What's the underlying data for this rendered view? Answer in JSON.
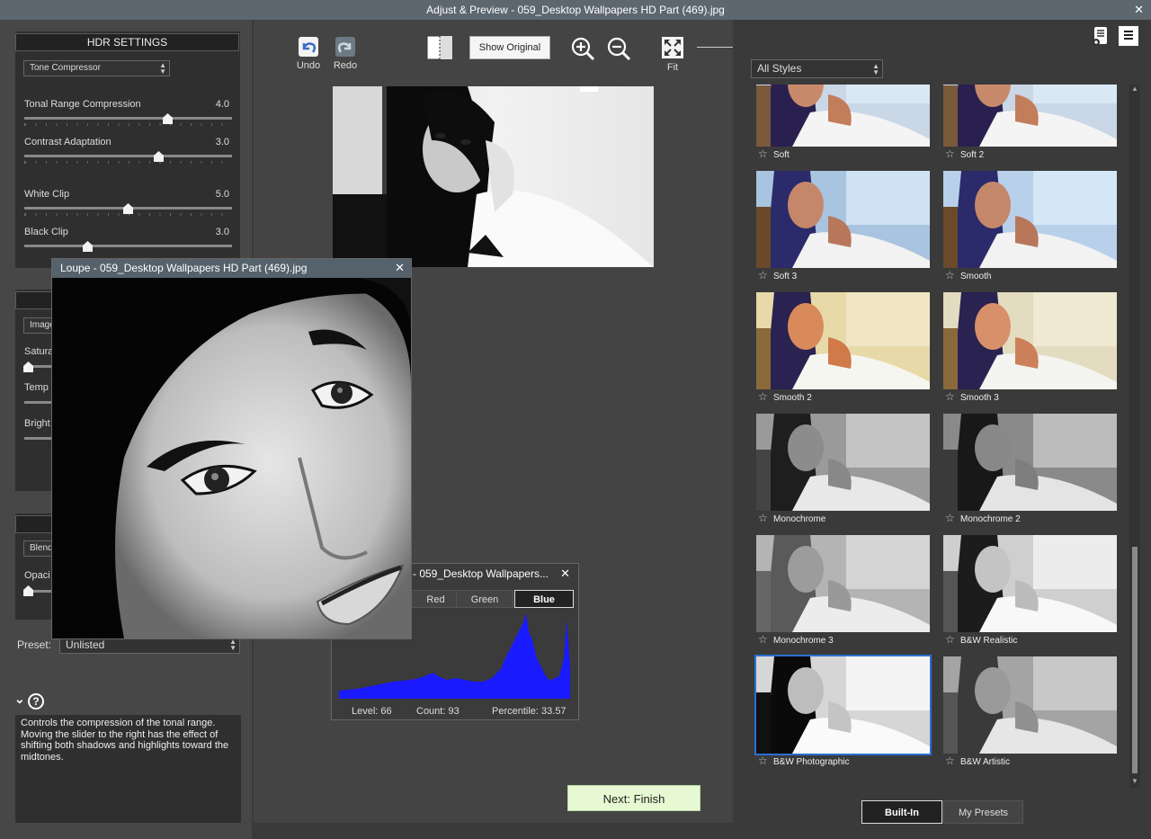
{
  "window": {
    "title": "Adjust & Preview - 059_Desktop Wallpapers  HD Part (469).jpg",
    "close_glyph": "✕"
  },
  "hdr": {
    "header": "HDR SETTINGS",
    "method": "Tone Compressor",
    "sliders": [
      {
        "label": "Tonal Range Compression",
        "value": "4.0",
        "level": 0.7
      },
      {
        "label": "Contrast Adaptation",
        "value": "3.0",
        "level": 0.65
      },
      {
        "label": "White Clip",
        "value": "5.0",
        "level": 0.5
      },
      {
        "label": "Black Clip",
        "value": "3.0",
        "level": 0.3
      }
    ]
  },
  "color": {
    "select_partial": "Image",
    "saturation_partial": "Satura",
    "temperature_partial": "Temp",
    "brightness_partial": "Bright"
  },
  "blend": {
    "select_partial": "Blend",
    "opacity_partial": "Opaci"
  },
  "preset": {
    "label": "Preset:",
    "value": "Unlisted"
  },
  "help": {
    "expand_glyph": "⌄",
    "question_glyph": "?",
    "text": "Controls the compression of the tonal range. Moving the slider to the right has the effect of shifting both shadows and highlights toward the midtones."
  },
  "toolbar": {
    "undo": "Undo",
    "redo": "Redo",
    "show_original": "Show Original",
    "fit": "Fit"
  },
  "loupe": {
    "title": "Loupe - 059_Desktop Wallpapers  HD Part (469).jpg",
    "close": "✕"
  },
  "histogram": {
    "title": "- 059_Desktop Wallpapers...",
    "close": "✕",
    "tabs": [
      "Red",
      "Green",
      "Blue"
    ],
    "active_tab": "Blue",
    "level": "Level: 66",
    "count": "Count: 93",
    "percentile": "Percentile: 33.57",
    "color": "#1a1aff"
  },
  "next_button": "Next: Finish",
  "styles": {
    "filter": "All Styles",
    "items": [
      {
        "label": "Soft",
        "tone": "color"
      },
      {
        "label": "Soft 2",
        "tone": "color"
      },
      {
        "label": "Soft 3",
        "tone": "color"
      },
      {
        "label": "Smooth",
        "tone": "color"
      },
      {
        "label": "Smooth 2",
        "tone": "warm"
      },
      {
        "label": "Smooth 3",
        "tone": "warm"
      },
      {
        "label": "Monochrome",
        "tone": "mono"
      },
      {
        "label": "Monochrome 2",
        "tone": "mono"
      },
      {
        "label": "Monochrome 3",
        "tone": "mono"
      },
      {
        "label": "B&W Realistic",
        "tone": "mono"
      },
      {
        "label": "B&W Photographic",
        "tone": "mono",
        "selected": true
      },
      {
        "label": "B&W Artistic",
        "tone": "mono"
      }
    ],
    "selected": "B&W Photographic"
  },
  "tabs": {
    "built_in": "Built-In",
    "my_presets": "My Presets",
    "active": "Built-In"
  },
  "colors": {
    "selection": "#2b6fd4",
    "next_button_bg": "#e6f9d2",
    "title_bar": "#5c6770"
  }
}
